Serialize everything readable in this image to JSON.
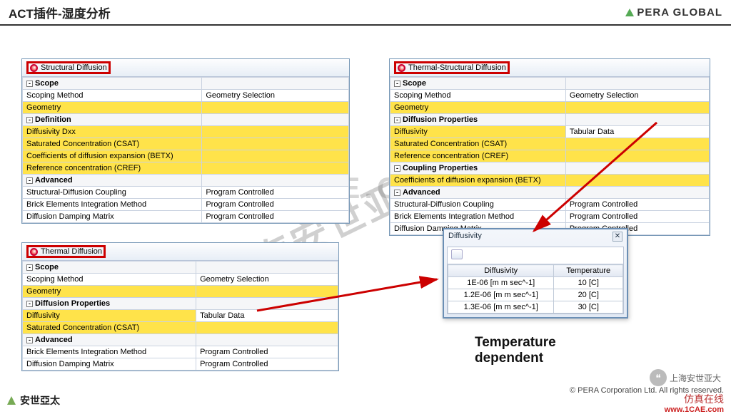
{
  "header": {
    "title": "ACT插件-湿度分析",
    "brand": "PERA GLOBAL"
  },
  "panels": {
    "structural": {
      "title": "Structural Diffusion",
      "rows": [
        {
          "head": "Scope"
        },
        {
          "k": "Scoping Method",
          "v": "Geometry Selection"
        },
        {
          "k": "Geometry",
          "hl": true
        },
        {
          "head": "Definition"
        },
        {
          "k": "Diffusivity Dxx",
          "hl": true
        },
        {
          "k": "Saturated Concentration (CSAT)",
          "hl": true
        },
        {
          "k": "Coefficients of diffusion expansion (BETX)",
          "hl": true
        },
        {
          "k": "Reference concentration (CREF)",
          "hl": true
        },
        {
          "head": "Advanced"
        },
        {
          "k": "Structural-Diffusion Coupling",
          "v": "Program Controlled"
        },
        {
          "k": "Brick Elements Integration Method",
          "v": "Program Controlled"
        },
        {
          "k": "Diffusion Damping Matrix",
          "v": "Program Controlled"
        }
      ]
    },
    "thermalStructural": {
      "title": "Thermal-Structural Diffusion",
      "rows": [
        {
          "head": "Scope"
        },
        {
          "k": "Scoping Method",
          "v": "Geometry Selection"
        },
        {
          "k": "Geometry",
          "hl": true
        },
        {
          "head": "Diffusion Properties"
        },
        {
          "k": "Diffusivity",
          "v": "Tabular Data",
          "hl": true
        },
        {
          "k": "Saturated Concentration (CSAT)",
          "hl": true
        },
        {
          "k": "Reference concentration (CREF)",
          "hl": true
        },
        {
          "head": "Coupling Properties"
        },
        {
          "k": "Coefficients of diffusion expansion (BETX)",
          "hl": true
        },
        {
          "head": "Advanced"
        },
        {
          "k": "Structural-Diffusion Coupling",
          "v": "Program Controlled"
        },
        {
          "k": "Brick Elements Integration Method",
          "v": "Program Controlled"
        },
        {
          "k": "Diffusion Damping Matrix",
          "v": "Program Controlled"
        }
      ]
    },
    "thermal": {
      "title": "Thermal Diffusion",
      "rows": [
        {
          "head": "Scope"
        },
        {
          "k": "Scoping Method",
          "v": "Geometry Selection"
        },
        {
          "k": "Geometry",
          "hl": true
        },
        {
          "head": "Diffusion Properties"
        },
        {
          "k": "Diffusivity",
          "v": "Tabular Data",
          "hl": true
        },
        {
          "k": "Saturated Concentration (CSAT)",
          "hl": true
        },
        {
          "head": "Advanced"
        },
        {
          "k": "Brick Elements Integration Method",
          "v": "Program Controlled"
        },
        {
          "k": "Diffusion Damping Matrix",
          "v": "Program Controlled"
        }
      ]
    }
  },
  "popup": {
    "title": "Diffusivity",
    "cols": [
      "Diffusivity",
      "Temperature"
    ],
    "rows": [
      [
        "1E-06 [m m sec^-1]",
        "10 [C]"
      ],
      [
        "1.2E-06 [m m sec^-1]",
        "20 [C]"
      ],
      [
        "1.3E-06 [m m sec^-1]",
        "30 [C]"
      ]
    ]
  },
  "tempLabel": "Temperature\ndependent",
  "watermarks": {
    "diag": "上海安世亚太资料分享",
    "center": "AE.C"
  },
  "wechat": "上海安世亚大",
  "footer": {
    "brand": "安世亞太",
    "copyright": "©  PERA Corporation Ltd. All rights reserved.",
    "hand": "仿真在线",
    "link": "www.1CAE.com"
  }
}
